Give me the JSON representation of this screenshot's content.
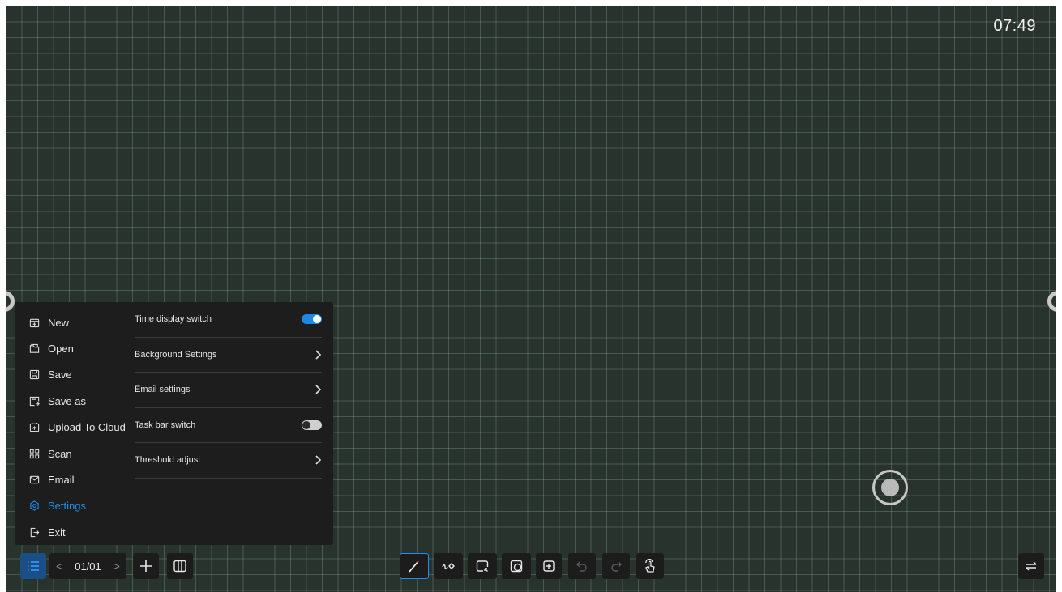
{
  "clock": {
    "time": "07:49"
  },
  "menu": {
    "items": [
      {
        "label": "New",
        "icon": "new-file-icon"
      },
      {
        "label": "Open",
        "icon": "open-folder-icon"
      },
      {
        "label": "Save",
        "icon": "save-icon"
      },
      {
        "label": "Save as",
        "icon": "save-as-icon"
      },
      {
        "label": "Upload To Cloud",
        "icon": "cloud-upload-icon"
      },
      {
        "label": "Scan",
        "icon": "qr-scan-icon"
      },
      {
        "label": "Email",
        "icon": "email-icon"
      },
      {
        "label": "Settings",
        "icon": "gear-icon",
        "active": true
      },
      {
        "label": "Exit",
        "icon": "exit-icon"
      }
    ],
    "active_color": "#1f8fef"
  },
  "settings": {
    "rows": [
      {
        "label": "Time display switch",
        "control": "toggle",
        "value": true
      },
      {
        "label": "Background Settings",
        "control": "chevron"
      },
      {
        "label": "Email settings",
        "control": "chevron"
      },
      {
        "label": "Task bar switch",
        "control": "toggle",
        "value": false
      },
      {
        "label": "Threshold adjust",
        "control": "chevron"
      }
    ]
  },
  "pager": {
    "page": "01/01"
  },
  "toolbar": {
    "tools": [
      "pen-icon",
      "eraser-icon",
      "select-icon",
      "shape-icon",
      "add-insert-icon",
      "undo-icon",
      "redo-icon",
      "gesture-icon"
    ]
  },
  "colors": {
    "board": "#28332e",
    "accent": "#1f8fef",
    "panel": "#1d1d1d"
  }
}
